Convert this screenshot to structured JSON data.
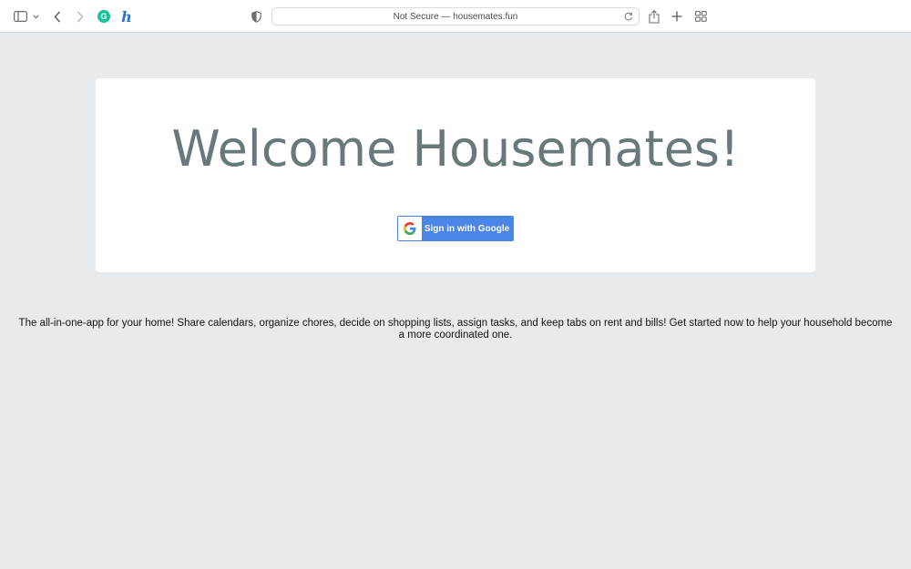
{
  "browser": {
    "url_text": "Not Secure — housemates.fun",
    "icons": [
      "sidebar-icon",
      "chevron-down-icon",
      "back-icon",
      "forward-icon",
      "grammarly-icon",
      "honey-icon",
      "shield-icon",
      "reload-icon",
      "share-icon",
      "new-tab-icon",
      "tab-overview-icon"
    ],
    "grammarly_letter": "G",
    "honey_letter": "h"
  },
  "main": {
    "title": "Welcome Housemates!",
    "signin_label": "Sign in with Google",
    "tagline": "The all-in-one-app for your home! Share calendars, organize chores, decide on shopping lists, assign tasks, and keep tabs on rent and bills! Get started now to help your household become a more coordinated one."
  },
  "colors": {
    "page_bg": "#e7ebee",
    "title": "#68797c",
    "google_button": "#4a86e8",
    "grammarly": "#15c39a",
    "honey": "#2f6fdb"
  }
}
